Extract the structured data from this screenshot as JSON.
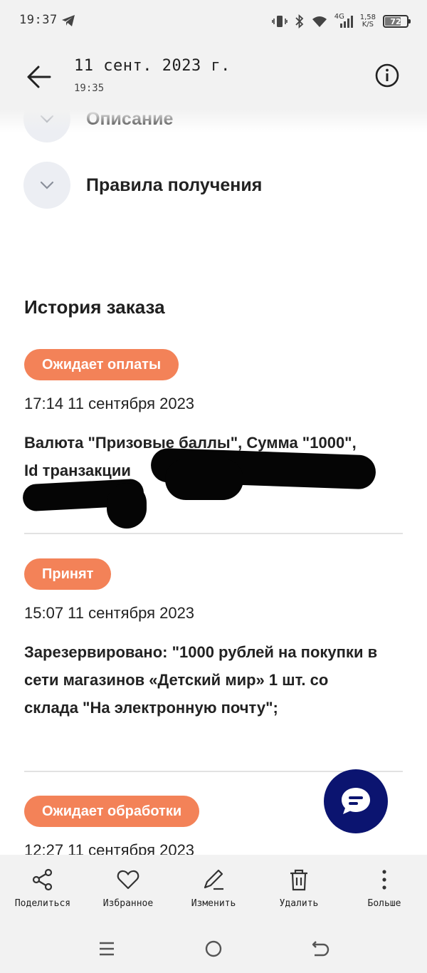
{
  "status_bar": {
    "time": "19:37",
    "net_speed_value": "1,58",
    "net_speed_unit": "K/S",
    "network_type": "4G",
    "battery": "72"
  },
  "app_bar": {
    "title": "11 сент. 2023 г.",
    "subtitle": "19:35"
  },
  "accordions": [
    {
      "label": "Описание"
    },
    {
      "label": "Правила получения"
    }
  ],
  "history": {
    "title": "История заказа",
    "entries": [
      {
        "status": "Ожидает оплаты",
        "date": "17:14 11 сентября 2023",
        "text_line1": "Валюта \"Призовые баллы\", Сумма \"1000\",",
        "text_line2": "Id транзакции"
      },
      {
        "status": "Принят",
        "date": "15:07 11 сентября 2023",
        "text": "Зарезервировано: \"1000 рублей на покупки в сети магазинов «Детский мир» 1 шт. со склада \"На электронную почту\";"
      },
      {
        "status": "Ожидает обработки",
        "date": "12:27 11 сентября 2023"
      }
    ]
  },
  "actions": {
    "share": "Поделиться",
    "favorite": "Избранное",
    "edit": "Изменить",
    "delete": "Удалить",
    "more": "Больше"
  },
  "colors": {
    "status_pill": "#f38258",
    "chat_fab": "#0b1470",
    "background": "#f2f2f2"
  },
  "icons": {
    "back": "arrow-left-icon",
    "info": "info-icon",
    "chat": "chat-bubble-icon",
    "share": "share-icon",
    "favorite": "heart-icon",
    "edit": "pencil-icon",
    "delete": "trash-icon",
    "more": "more-vertical-icon"
  }
}
